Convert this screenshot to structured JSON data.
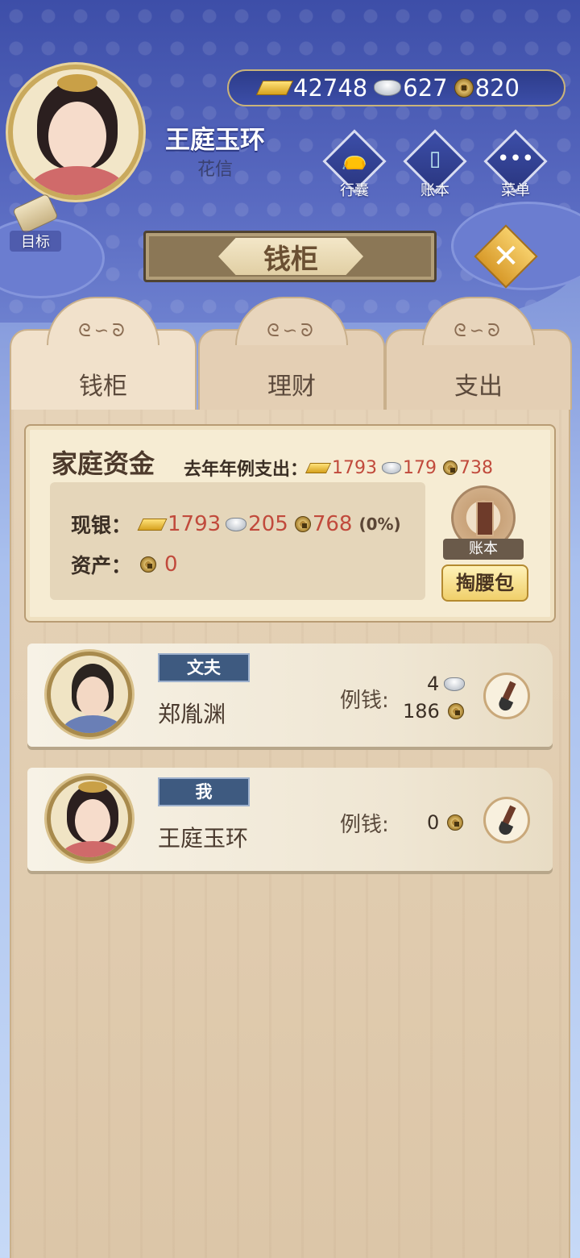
{
  "player": {
    "name": "王庭玉环",
    "subtitle": "花信"
  },
  "currency": {
    "gold": "42748",
    "silver": "627",
    "copper": "820"
  },
  "top_menu": [
    {
      "label": "行囊",
      "icon": "bag-icon"
    },
    {
      "label": "账本",
      "icon": "ledger-icon"
    },
    {
      "label": "菜单",
      "icon": "more-icon"
    }
  ],
  "goal_label": "目标",
  "title": "钱柜",
  "tabs": [
    {
      "label": "钱柜",
      "active": true
    },
    {
      "label": "理财",
      "active": false
    },
    {
      "label": "支出",
      "active": false
    }
  ],
  "fund": {
    "title": "家庭资金",
    "last_year_label": "去年年例支出：",
    "last_year_gold": "1793",
    "last_year_silver": "179",
    "last_year_copper": "738",
    "cash_label": "现银：",
    "cash_gold": "1793",
    "cash_silver": "205",
    "cash_copper": "768",
    "cash_pct": "(0%)",
    "assets_label": "资产：",
    "assets_value": "0",
    "ledger_label": "账本",
    "pocket_button": "掏腰包"
  },
  "members": [
    {
      "role": "文夫",
      "name": "郑胤渊",
      "allowance_label": "例钱:",
      "allowance_silver": "4",
      "allowance_copper": "186"
    },
    {
      "role": "我",
      "name": "王庭玉环",
      "allowance_label": "例钱:",
      "allowance_copper": "0"
    }
  ],
  "colors": {
    "accent_red": "#c14a3c",
    "role_tag": "#3e5a80",
    "panel_wood": "#e6d3b8"
  }
}
